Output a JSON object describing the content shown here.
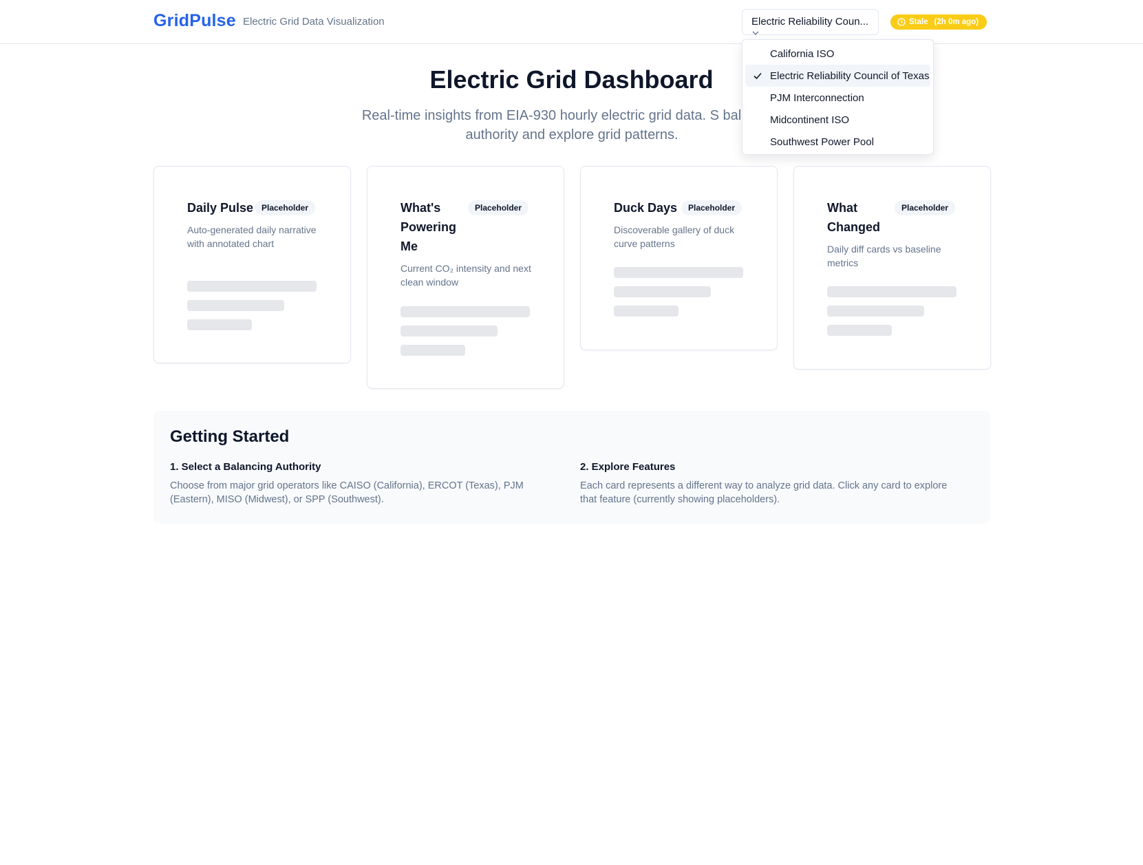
{
  "header": {
    "brand": "GridPulse",
    "tagline": "Electric Grid Data Visualization",
    "ba_select": {
      "value": "Electric Reliability Coun..."
    },
    "status": {
      "label": "Stale",
      "age": "(2h 0m ago)",
      "color": "#facc15"
    }
  },
  "dropdown": {
    "options": [
      {
        "label": "California ISO",
        "selected": false
      },
      {
        "label": "Electric Reliability Council of Texas",
        "selected": true
      },
      {
        "label": "PJM Interconnection",
        "selected": false
      },
      {
        "label": "Midcontinent ISO",
        "selected": false
      },
      {
        "label": "Southwest Power Pool",
        "selected": false
      }
    ]
  },
  "hero": {
    "title": "Electric Grid Dashboard",
    "subtitle": "Real-time insights from EIA-930 hourly electric grid data. S balancing authority and explore grid patterns."
  },
  "cards": [
    {
      "title": "Daily Pulse",
      "badge": "Placeholder",
      "description": "Auto-generated daily narrative with annotated chart"
    },
    {
      "title": "What's Powering Me",
      "badge": "Placeholder",
      "description": "Current CO₂ intensity and next clean window"
    },
    {
      "title": "Duck Days",
      "badge": "Placeholder",
      "description": "Discoverable gallery of duck curve patterns"
    },
    {
      "title": "What Changed",
      "badge": "Placeholder",
      "description": "Daily diff cards vs baseline metrics"
    }
  ],
  "getting_started": {
    "title": "Getting Started",
    "steps": [
      {
        "heading": "1. Select a Balancing Authority",
        "text": "Choose from major grid operators like CAISO (California), ERCOT (Texas), PJM (Eastern), MISO (Midwest), or SPP (Southwest)."
      },
      {
        "heading": "2. Explore Features",
        "text": "Each card represents a different way to analyze grid data. Click any card to explore that feature (currently showing placeholders)."
      }
    ]
  },
  "colors": {
    "brand": "#2563eb",
    "stale": "#facc15",
    "muted_text": "#64748b"
  }
}
